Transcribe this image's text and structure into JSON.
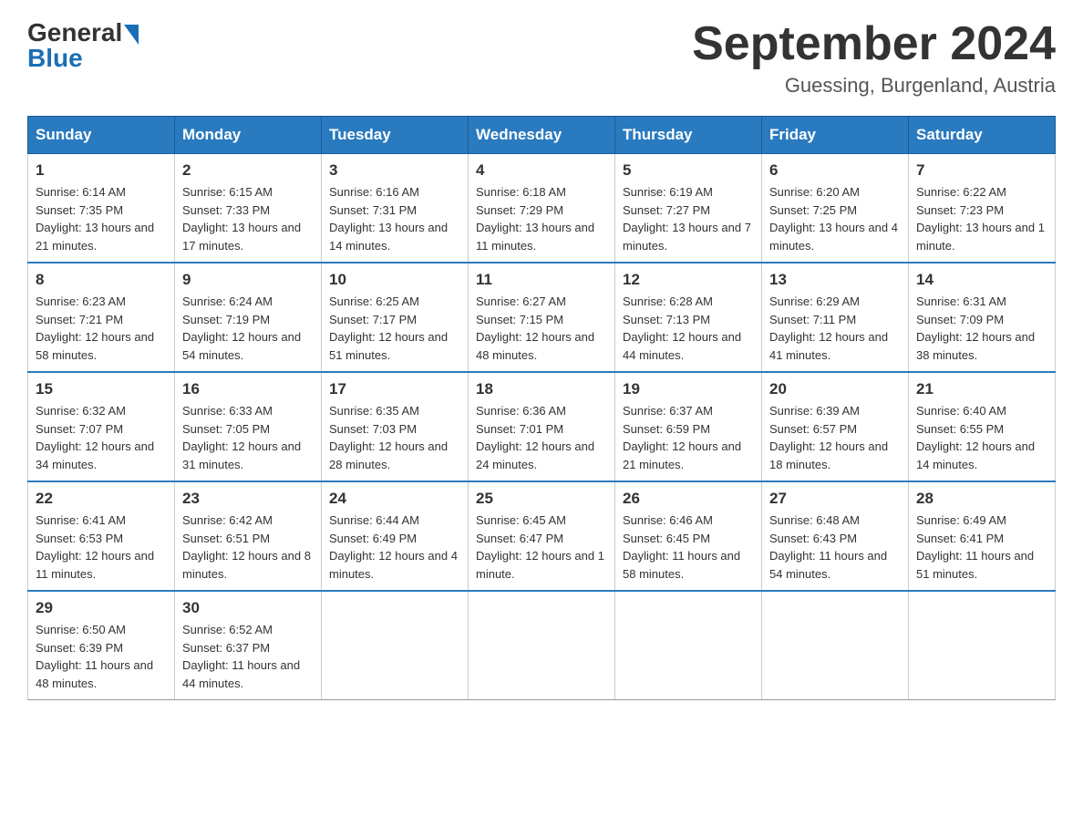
{
  "logo": {
    "general": "General",
    "blue": "Blue"
  },
  "title": "September 2024",
  "location": "Guessing, Burgenland, Austria",
  "days_of_week": [
    "Sunday",
    "Monday",
    "Tuesday",
    "Wednesday",
    "Thursday",
    "Friday",
    "Saturday"
  ],
  "weeks": [
    [
      {
        "day": "1",
        "sunrise": "6:14 AM",
        "sunset": "7:35 PM",
        "daylight": "13 hours and 21 minutes."
      },
      {
        "day": "2",
        "sunrise": "6:15 AM",
        "sunset": "7:33 PM",
        "daylight": "13 hours and 17 minutes."
      },
      {
        "day": "3",
        "sunrise": "6:16 AM",
        "sunset": "7:31 PM",
        "daylight": "13 hours and 14 minutes."
      },
      {
        "day": "4",
        "sunrise": "6:18 AM",
        "sunset": "7:29 PM",
        "daylight": "13 hours and 11 minutes."
      },
      {
        "day": "5",
        "sunrise": "6:19 AM",
        "sunset": "7:27 PM",
        "daylight": "13 hours and 7 minutes."
      },
      {
        "day": "6",
        "sunrise": "6:20 AM",
        "sunset": "7:25 PM",
        "daylight": "13 hours and 4 minutes."
      },
      {
        "day": "7",
        "sunrise": "6:22 AM",
        "sunset": "7:23 PM",
        "daylight": "13 hours and 1 minute."
      }
    ],
    [
      {
        "day": "8",
        "sunrise": "6:23 AM",
        "sunset": "7:21 PM",
        "daylight": "12 hours and 58 minutes."
      },
      {
        "day": "9",
        "sunrise": "6:24 AM",
        "sunset": "7:19 PM",
        "daylight": "12 hours and 54 minutes."
      },
      {
        "day": "10",
        "sunrise": "6:25 AM",
        "sunset": "7:17 PM",
        "daylight": "12 hours and 51 minutes."
      },
      {
        "day": "11",
        "sunrise": "6:27 AM",
        "sunset": "7:15 PM",
        "daylight": "12 hours and 48 minutes."
      },
      {
        "day": "12",
        "sunrise": "6:28 AM",
        "sunset": "7:13 PM",
        "daylight": "12 hours and 44 minutes."
      },
      {
        "day": "13",
        "sunrise": "6:29 AM",
        "sunset": "7:11 PM",
        "daylight": "12 hours and 41 minutes."
      },
      {
        "day": "14",
        "sunrise": "6:31 AM",
        "sunset": "7:09 PM",
        "daylight": "12 hours and 38 minutes."
      }
    ],
    [
      {
        "day": "15",
        "sunrise": "6:32 AM",
        "sunset": "7:07 PM",
        "daylight": "12 hours and 34 minutes."
      },
      {
        "day": "16",
        "sunrise": "6:33 AM",
        "sunset": "7:05 PM",
        "daylight": "12 hours and 31 minutes."
      },
      {
        "day": "17",
        "sunrise": "6:35 AM",
        "sunset": "7:03 PM",
        "daylight": "12 hours and 28 minutes."
      },
      {
        "day": "18",
        "sunrise": "6:36 AM",
        "sunset": "7:01 PM",
        "daylight": "12 hours and 24 minutes."
      },
      {
        "day": "19",
        "sunrise": "6:37 AM",
        "sunset": "6:59 PM",
        "daylight": "12 hours and 21 minutes."
      },
      {
        "day": "20",
        "sunrise": "6:39 AM",
        "sunset": "6:57 PM",
        "daylight": "12 hours and 18 minutes."
      },
      {
        "day": "21",
        "sunrise": "6:40 AM",
        "sunset": "6:55 PM",
        "daylight": "12 hours and 14 minutes."
      }
    ],
    [
      {
        "day": "22",
        "sunrise": "6:41 AM",
        "sunset": "6:53 PM",
        "daylight": "12 hours and 11 minutes."
      },
      {
        "day": "23",
        "sunrise": "6:42 AM",
        "sunset": "6:51 PM",
        "daylight": "12 hours and 8 minutes."
      },
      {
        "day": "24",
        "sunrise": "6:44 AM",
        "sunset": "6:49 PM",
        "daylight": "12 hours and 4 minutes."
      },
      {
        "day": "25",
        "sunrise": "6:45 AM",
        "sunset": "6:47 PM",
        "daylight": "12 hours and 1 minute."
      },
      {
        "day": "26",
        "sunrise": "6:46 AM",
        "sunset": "6:45 PM",
        "daylight": "11 hours and 58 minutes."
      },
      {
        "day": "27",
        "sunrise": "6:48 AM",
        "sunset": "6:43 PM",
        "daylight": "11 hours and 54 minutes."
      },
      {
        "day": "28",
        "sunrise": "6:49 AM",
        "sunset": "6:41 PM",
        "daylight": "11 hours and 51 minutes."
      }
    ],
    [
      {
        "day": "29",
        "sunrise": "6:50 AM",
        "sunset": "6:39 PM",
        "daylight": "11 hours and 48 minutes."
      },
      {
        "day": "30",
        "sunrise": "6:52 AM",
        "sunset": "6:37 PM",
        "daylight": "11 hours and 44 minutes."
      },
      null,
      null,
      null,
      null,
      null
    ]
  ],
  "labels": {
    "sunrise": "Sunrise:",
    "sunset": "Sunset:",
    "daylight": "Daylight:"
  }
}
